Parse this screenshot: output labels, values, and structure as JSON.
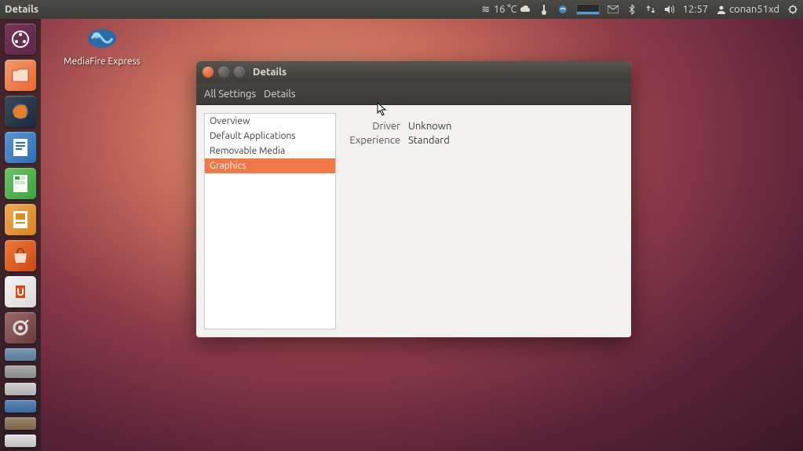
{
  "top_panel": {
    "title": "Details",
    "weather": "16 °C",
    "time": "12:57",
    "user": "conan51xd"
  },
  "desktop": {
    "icon_label": "MediaFire Express"
  },
  "launcher": {
    "items": [
      {
        "name": "dash",
        "bg": "#6b2846"
      },
      {
        "name": "files",
        "bg": "#f07746"
      },
      {
        "name": "firefox",
        "bg": "#2b3a4a"
      },
      {
        "name": "writer",
        "bg": "#2d6fb4"
      },
      {
        "name": "calc",
        "bg": "#3aa33a"
      },
      {
        "name": "impress",
        "bg": "#e08a2c"
      },
      {
        "name": "software-center",
        "bg": "#d9480f"
      },
      {
        "name": "ubuntu-one",
        "bg": "#e3e3e3"
      },
      {
        "name": "settings",
        "bg": "#7a4a4a"
      }
    ],
    "stack": [
      {
        "bg": "#6a8aa8"
      },
      {
        "bg": "#9a9a9a"
      },
      {
        "bg": "#c0c0c0"
      },
      {
        "bg": "#4a78aa"
      },
      {
        "bg": "#8b755c"
      },
      {
        "bg": "#d0d0d0"
      }
    ]
  },
  "window": {
    "title": "Details",
    "breadcrumb": {
      "all": "All Settings",
      "current": "Details"
    },
    "sidebar": {
      "items": [
        {
          "label": "Overview",
          "sel": false
        },
        {
          "label": "Default Applications",
          "sel": false
        },
        {
          "label": "Removable Media",
          "sel": false
        },
        {
          "label": "Graphics",
          "sel": true
        }
      ]
    },
    "detail": {
      "rows": [
        {
          "k": "Driver",
          "v": "Unknown"
        },
        {
          "k": "Experience",
          "v": "Standard"
        }
      ]
    }
  }
}
